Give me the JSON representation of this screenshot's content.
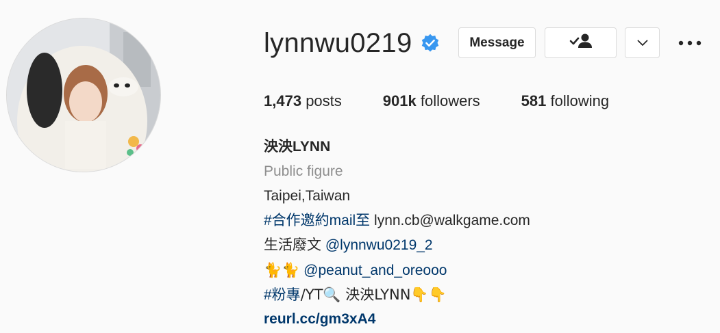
{
  "profile": {
    "username": "lynnwu0219",
    "verified_icon": "verified-badge-icon",
    "buttons": {
      "message_label": "Message"
    },
    "stats": {
      "posts_count": "1,473",
      "posts_label": "posts",
      "followers_count": "901k",
      "followers_label": "followers",
      "following_count": "581",
      "following_label": "following"
    },
    "bio": {
      "full_name": "泱泱LYNN",
      "category": "Public figure",
      "location": "Taipei,Taiwan",
      "line4_hashtag": "#合作邀約mail至",
      "line4_text": " lynn.cb@walkgame.com",
      "line5_text": "生活廢文 ",
      "line5_mention": "@lynnwu0219_2",
      "line6_emoji": "🐈🐈",
      "line6_mention": "@peanut_and_oreooo",
      "line7_hashtag": "#粉專",
      "line7_text": "/YT🔍 泱泱LYNN👇👇",
      "website": "reurl.cc/gm3xA4"
    }
  },
  "colors": {
    "background": "#fafafa",
    "text": "#262626",
    "muted": "#8e8e8e",
    "link": "#00376b",
    "verified_blue": "#3897f0",
    "border": "#dbdbdb"
  }
}
